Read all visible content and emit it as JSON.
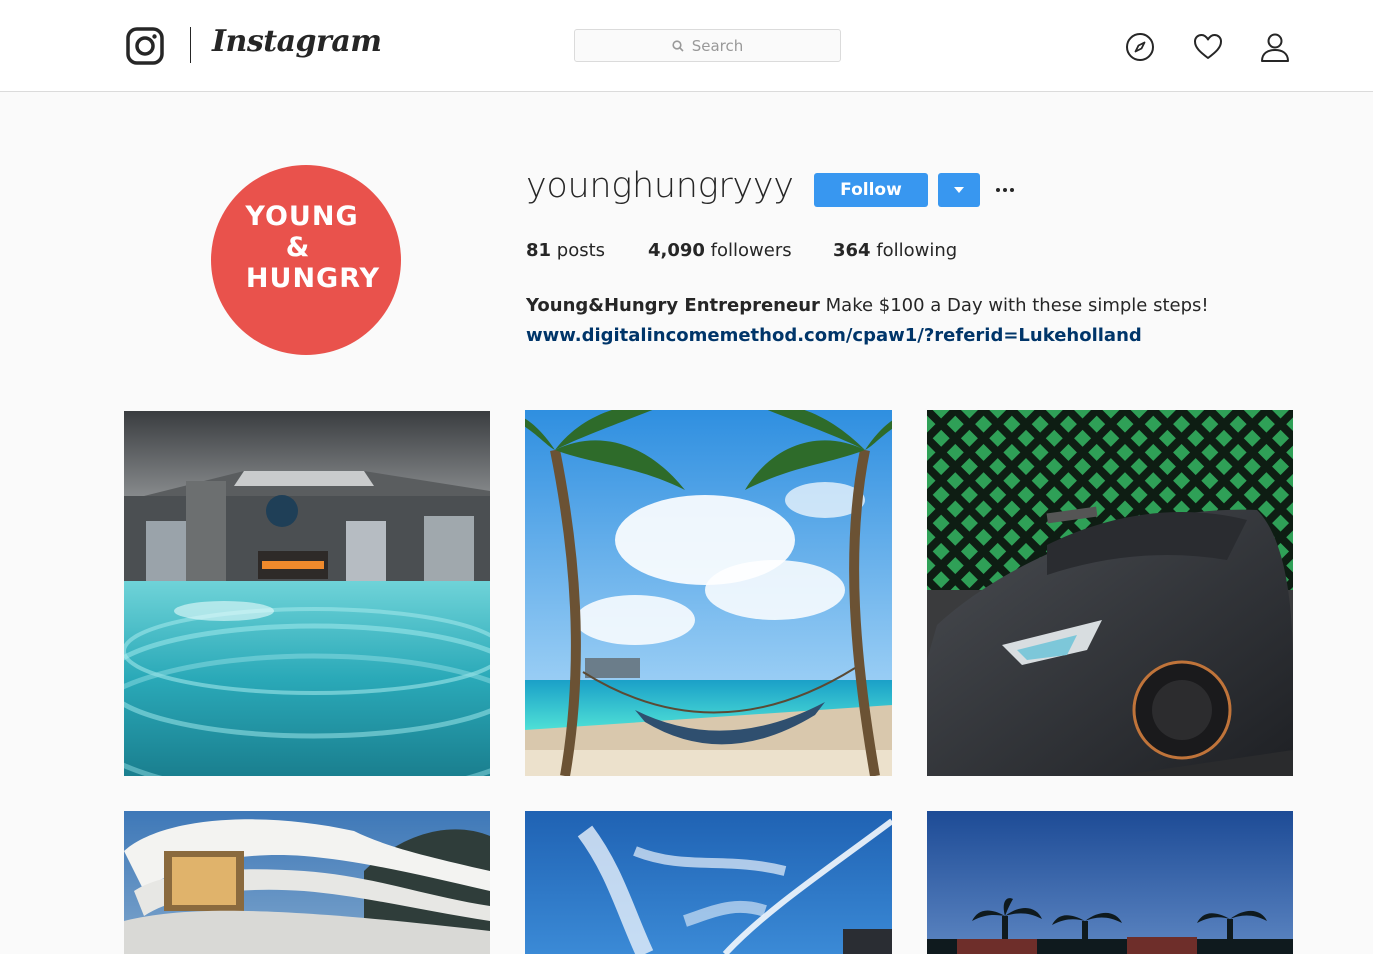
{
  "nav": {
    "wordmark": "Instagram",
    "search_placeholder": "Search",
    "icons": [
      "instagram-glyph-icon",
      "explore-compass-icon",
      "activity-heart-icon",
      "profile-person-icon"
    ]
  },
  "profile": {
    "avatar_lines": [
      "YOUNG",
      "&",
      "HUNGRY"
    ],
    "username": "younghungryyy",
    "follow_label": "Follow",
    "stats": {
      "posts_count": "81",
      "posts_label": "posts",
      "followers_count": "4,090",
      "followers_label": "followers",
      "following_count": "364",
      "following_label": "following"
    },
    "bio_name": "Young&Hungry Entrepreneur",
    "bio_text": "Make $100 a Day with these simple steps!",
    "bio_link": "www.digitalincomemethod.com/cpaw1/?referid=Lukeholland"
  },
  "colors": {
    "accent": "#3897f0",
    "avatar_bg": "#e9524c",
    "link": "#003569"
  },
  "posts": [
    {
      "subject": "indoor pool"
    },
    {
      "subject": "palm trees hammock beach"
    },
    {
      "subject": "grey supercar"
    },
    {
      "subject": "modern white villa"
    },
    {
      "subject": "blue sky contrails"
    },
    {
      "subject": "palm trees dusk"
    }
  ]
}
